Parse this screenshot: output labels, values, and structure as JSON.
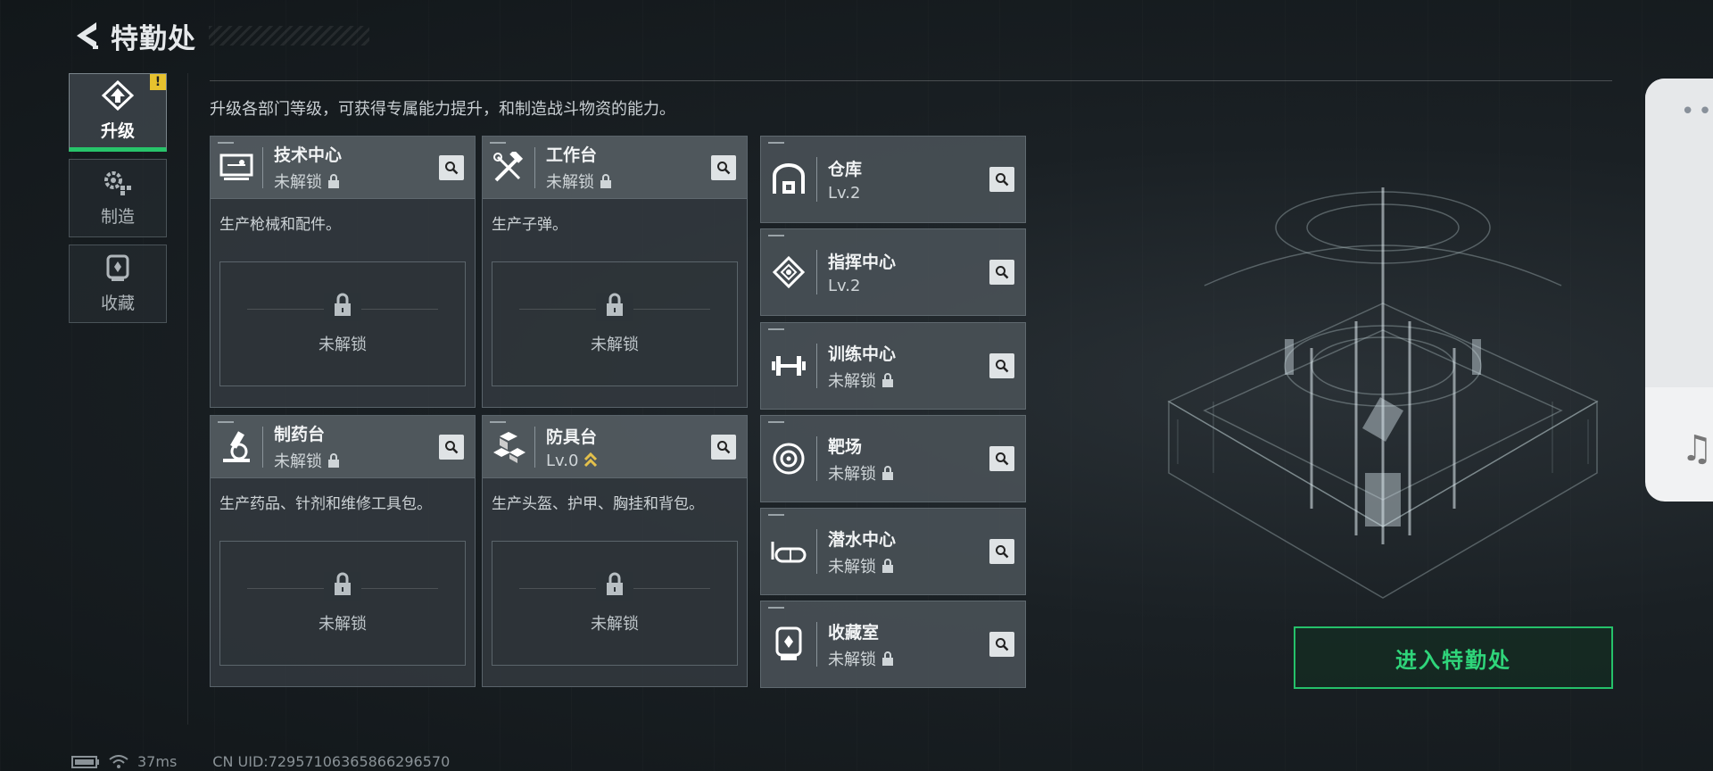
{
  "header": {
    "title": "特勤处"
  },
  "sidebar": {
    "tabs": [
      {
        "label": "升级",
        "active": true,
        "badge": "!"
      },
      {
        "label": "制造"
      },
      {
        "label": "收藏"
      }
    ]
  },
  "description": "升级各部门等级，可获得专属能力提升，和制造战斗物资的能力。",
  "cards": [
    {
      "name": "技术中心",
      "status": "未解锁",
      "desc": "生产枪械和配件。",
      "locked_text": "未解锁",
      "icon": "monitor-icon"
    },
    {
      "name": "工作台",
      "status": "未解锁",
      "desc": "生产子弹。",
      "locked_text": "未解锁",
      "icon": "tools-icon"
    },
    {
      "name": "制药台",
      "status": "未解锁",
      "desc": "生产药品、针剂和维修工具包。",
      "locked_text": "未解锁",
      "icon": "microscope-icon"
    },
    {
      "name": "防具台",
      "status": "Lv.0",
      "desc": "生产头盔、护甲、胸挂和背包。",
      "locked_text": "未解锁",
      "icon": "boxes-icon"
    }
  ],
  "small_cards": [
    {
      "name": "仓库",
      "status": "Lv.2",
      "icon": "warehouse-icon"
    },
    {
      "name": "指挥中心",
      "status": "Lv.2",
      "icon": "chip-icon"
    },
    {
      "name": "训练中心",
      "status": "未解锁",
      "icon": "dumbbell-icon"
    },
    {
      "name": "靶场",
      "status": "未解锁",
      "icon": "target-icon"
    },
    {
      "name": "潜水中心",
      "status": "未解锁",
      "icon": "goggles-icon"
    },
    {
      "name": "收藏室",
      "status": "未解锁",
      "icon": "trophy-icon"
    }
  ],
  "enter_button": "进入特勤处",
  "footer": {
    "ping": "37ms",
    "uid": "CN UID:72957106365866296570"
  },
  "colors": {
    "accent": "#25c16a",
    "warning": "#e7c22e"
  }
}
